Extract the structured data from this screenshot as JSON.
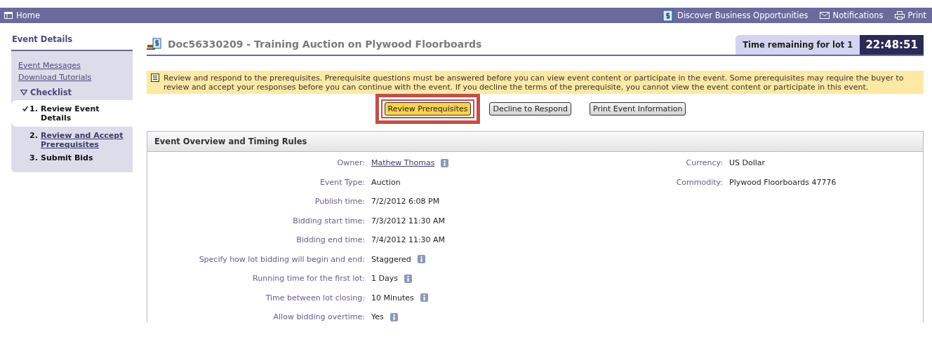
{
  "topbar": {
    "home": "Home",
    "links": [
      {
        "kind": "opportunities",
        "label": "Discover Business Opportunities"
      },
      {
        "kind": "notifications",
        "label": "Notifications"
      },
      {
        "kind": "print",
        "label": "Print"
      }
    ]
  },
  "sidebar": {
    "title": "Event Details",
    "links": [
      "Event Messages",
      "Download Tutorials"
    ],
    "checklist": {
      "title": "Checklist",
      "expanded": true,
      "items": [
        {
          "number": "1.",
          "label": "Review Event Details",
          "checked": true,
          "selected": true,
          "linked": false
        },
        {
          "number": "2.",
          "label": "Review and Accept Prerequisites",
          "checked": false,
          "selected": false,
          "linked": true
        },
        {
          "number": "3.",
          "label": "Submit Bids",
          "checked": false,
          "selected": false,
          "linked": false
        }
      ]
    }
  },
  "header": {
    "title": "Doc56330209 - Training Auction on Plywood Floorboards",
    "timer_label": "Time remaining for lot 1",
    "timer": "22:48:51"
  },
  "notice": "Review and respond to the prerequisites. Prerequisite questions must be answered before you can view event content or participate in the event. Some prerequisites may require the buyer to review and accept your responses before you can continue with the event. If you decline the terms of the prerequisite, you cannot view the event content or participate in this event.",
  "actions": [
    {
      "label": "Review Prerequisites",
      "primary": true,
      "highlighted": true
    },
    {
      "label": "Decline to Respond",
      "primary": false,
      "highlighted": false
    },
    {
      "label": "Print Event Information",
      "primary": false,
      "highlighted": false
    }
  ],
  "overview": {
    "title": "Event Overview and Timing Rules",
    "left": [
      {
        "label": "Owner:",
        "value": "Mathew Thomas",
        "kind": "link",
        "info": true
      },
      {
        "label": "Event Type:",
        "value": "Auction",
        "kind": "text",
        "info": false
      },
      {
        "label": "Publish time:",
        "value": "7/2/2012 6:08 PM",
        "kind": "text",
        "info": false
      },
      {
        "label": "Bidding start time:",
        "value": "7/3/2012 11:30 AM",
        "kind": "text",
        "info": false
      },
      {
        "label": "Bidding end time:",
        "value": "7/4/2012 11:30 AM",
        "kind": "text",
        "info": false
      },
      {
        "label": "Specify how lot bidding will begin and end:",
        "value": "Staggered",
        "kind": "text",
        "info": true
      },
      {
        "label": "Running time for the first lot:",
        "value": "1 Days",
        "kind": "text",
        "info": true
      },
      {
        "label": "Time between lot closing:",
        "value": "10 Minutes",
        "kind": "text",
        "info": true
      },
      {
        "label": "Allow bidding overtime:",
        "value": "Yes",
        "kind": "text",
        "info": true
      }
    ],
    "right": [
      {
        "label": "Currency:",
        "value": "US Dollar",
        "kind": "text",
        "info": false
      },
      {
        "label": "Commodity:",
        "value": "Plywood Floorboards 47776",
        "kind": "text",
        "info": false
      }
    ]
  }
}
